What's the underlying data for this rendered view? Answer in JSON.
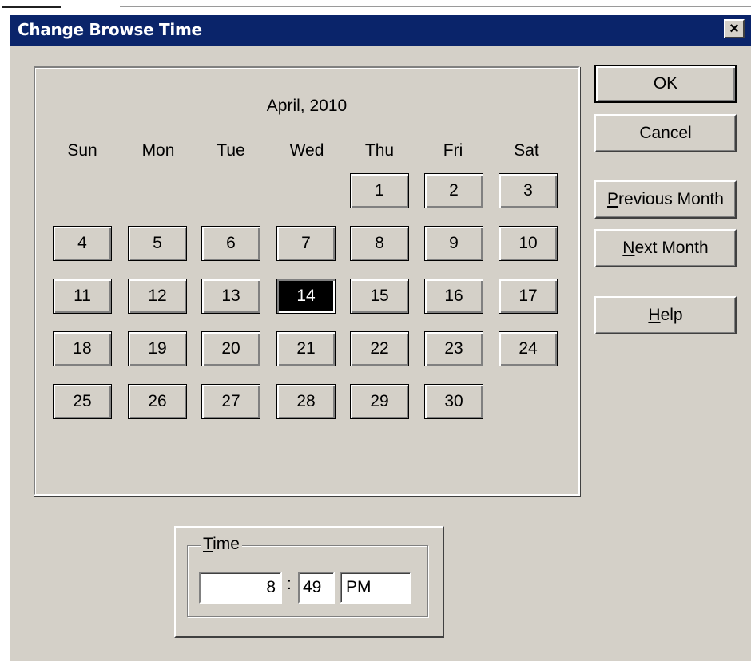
{
  "dialog": {
    "title": "Change Browse Time",
    "close_label": "×"
  },
  "calendar": {
    "month_label": "April, 2010",
    "weekdays": [
      "Sun",
      "Mon",
      "Tue",
      "Wed",
      "Thu",
      "Fri",
      "Sat"
    ],
    "days": [
      "1",
      "2",
      "3",
      "4",
      "5",
      "6",
      "7",
      "8",
      "9",
      "10",
      "11",
      "12",
      "13",
      "14",
      "15",
      "16",
      "17",
      "18",
      "19",
      "20",
      "21",
      "22",
      "23",
      "24",
      "25",
      "26",
      "27",
      "28",
      "29",
      "30"
    ],
    "first_weekday_index": 4,
    "selected_day": "14"
  },
  "buttons": {
    "ok": "OK",
    "cancel": "Cancel",
    "previous_month_mnemonic": "P",
    "previous_month_rest": "revious Month",
    "next_month_mnemonic": "N",
    "next_month_rest": "ext Month",
    "help_mnemonic": "H",
    "help_rest": "elp"
  },
  "time": {
    "legend_mnemonic": "T",
    "legend_rest": "ime",
    "hour": "8",
    "separator": ":",
    "minute": "49",
    "ampm": "PM"
  }
}
